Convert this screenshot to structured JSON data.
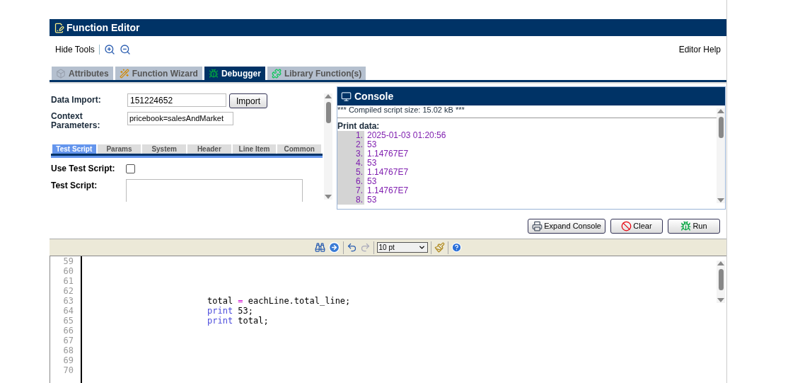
{
  "window": {
    "title": "Function Editor"
  },
  "toolbar": {
    "hide_tools": "Hide Tools",
    "editor_help": "Editor Help"
  },
  "tabs": [
    {
      "label": "Attributes",
      "selected": false
    },
    {
      "label": "Function Wizard",
      "selected": false
    },
    {
      "label": "Debugger",
      "selected": true
    },
    {
      "label": "Library Function(s)",
      "selected": false
    }
  ],
  "debugger": {
    "data_import": {
      "label": "Data Import:",
      "value": "151224652",
      "button": "Import"
    },
    "context": {
      "label": "Context Parameters:",
      "value": "pricebook=salesAndMarket"
    },
    "sub_tabs": [
      {
        "label": "Test Script",
        "selected": true
      },
      {
        "label": "Params",
        "selected": false
      },
      {
        "label": "System",
        "selected": false
      },
      {
        "label": "Header",
        "selected": false
      },
      {
        "label": "Line Item",
        "selected": false
      },
      {
        "label": "Common",
        "selected": false
      }
    ],
    "use_test_script": {
      "label": "Use Test Script:",
      "checked": false
    },
    "test_script": {
      "label": "Test Script:"
    }
  },
  "console": {
    "title": "Console",
    "summary": "*** Compiled script size: 15.02 kB ***",
    "print_label": "Print data:",
    "lines": [
      {
        "number": "1.",
        "text": "2025-01-03 01:20:56"
      },
      {
        "number": "2.",
        "text": "53"
      },
      {
        "number": "3.",
        "text": "1.14767E7"
      },
      {
        "number": "4.",
        "text": "53"
      },
      {
        "number": "5.",
        "text": "1.14767E7"
      },
      {
        "number": "6.",
        "text": "53"
      },
      {
        "number": "7.",
        "text": "1.14767E7"
      },
      {
        "number": "8.",
        "text": "53"
      }
    ]
  },
  "actions": [
    {
      "label": "Expand Console"
    },
    {
      "label": "Clear"
    },
    {
      "label": "Run"
    }
  ],
  "editor_toolbar": {
    "font_size": "10 pt"
  },
  "code": [
    {
      "number": "59"
    },
    {
      "number": "60"
    },
    {
      "number": "61"
    },
    {
      "number": "62"
    },
    {
      "number": "63",
      "tokens": [
        {
          "kind": "plain",
          "text": "total "
        },
        {
          "kind": "operator",
          "text": "="
        },
        {
          "kind": "plain",
          "text": " eachLine.total_line;"
        }
      ]
    },
    {
      "number": "64",
      "tokens": [
        {
          "kind": "keyword",
          "text": "print"
        },
        {
          "kind": "plain",
          "text": " 53;"
        }
      ]
    },
    {
      "number": "65",
      "tokens": [
        {
          "kind": "keyword",
          "text": "print"
        },
        {
          "kind": "plain",
          "text": " total;"
        }
      ]
    },
    {
      "number": "66"
    },
    {
      "number": "67"
    },
    {
      "number": "68"
    },
    {
      "number": "69"
    },
    {
      "number": "70"
    }
  ]
}
